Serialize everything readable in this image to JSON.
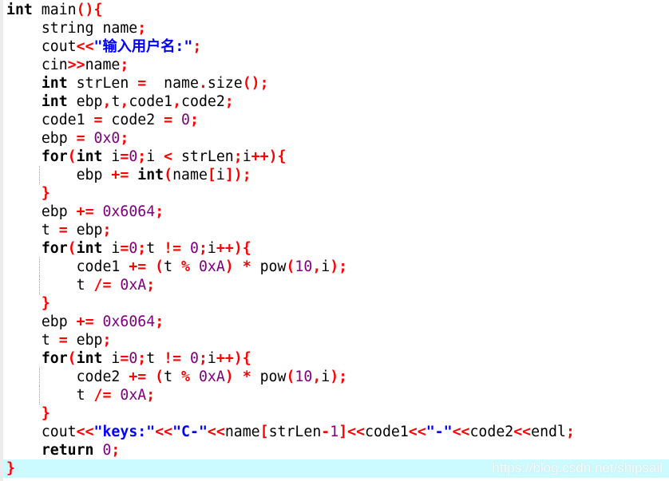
{
  "colors": {
    "keyword": "#000000",
    "operator": "#ff0000",
    "number": "#800080",
    "string": "#0000ff",
    "current_line": "#ccfbff"
  },
  "watermark": "https://blog.csdn.net/shipsail",
  "current_line": 26,
  "lines": [
    {
      "indent": 0,
      "tokens": [
        [
          "int",
          "k"
        ],
        [
          " main",
          "p"
        ],
        [
          "(){",
          "o"
        ]
      ]
    },
    {
      "indent": 1,
      "tokens": [
        [
          "string name",
          "p"
        ],
        [
          ";",
          "o"
        ]
      ]
    },
    {
      "indent": 1,
      "tokens": [
        [
          "cout",
          "p"
        ],
        [
          "<<",
          "o"
        ],
        [
          "\"输入用户名:\"",
          "s"
        ],
        [
          ";",
          "o"
        ]
      ]
    },
    {
      "indent": 1,
      "tokens": [
        [
          "cin",
          "p"
        ],
        [
          ">>",
          "o"
        ],
        [
          "name",
          "p"
        ],
        [
          ";",
          "o"
        ]
      ]
    },
    {
      "indent": 1,
      "tokens": [
        [
          "int",
          "k"
        ],
        [
          " strLen ",
          "p"
        ],
        [
          "=",
          "o"
        ],
        [
          "  name",
          "p"
        ],
        [
          ".",
          "o"
        ],
        [
          "size",
          "p"
        ],
        [
          "();",
          "o"
        ]
      ]
    },
    {
      "indent": 1,
      "tokens": [
        [
          "int",
          "k"
        ],
        [
          " ebp",
          "p"
        ],
        [
          ",",
          "o"
        ],
        [
          "t",
          "p"
        ],
        [
          ",",
          "o"
        ],
        [
          "code1",
          "p"
        ],
        [
          ",",
          "o"
        ],
        [
          "code2",
          "p"
        ],
        [
          ";",
          "o"
        ]
      ]
    },
    {
      "indent": 1,
      "tokens": [
        [
          "code1 ",
          "p"
        ],
        [
          "=",
          "o"
        ],
        [
          " code2 ",
          "p"
        ],
        [
          "=",
          "o"
        ],
        [
          " ",
          "p"
        ],
        [
          "0",
          "n"
        ],
        [
          ";",
          "o"
        ]
      ]
    },
    {
      "indent": 1,
      "tokens": [
        [
          "ebp ",
          "p"
        ],
        [
          "=",
          "o"
        ],
        [
          " ",
          "p"
        ],
        [
          "0x0",
          "n"
        ],
        [
          ";",
          "o"
        ]
      ]
    },
    {
      "indent": 1,
      "tokens": [
        [
          "for",
          "k"
        ],
        [
          "(",
          "o"
        ],
        [
          "int",
          "k"
        ],
        [
          " i",
          "p"
        ],
        [
          "=",
          "o"
        ],
        [
          "0",
          "n"
        ],
        [
          ";",
          "o"
        ],
        [
          "i ",
          "p"
        ],
        [
          "<",
          "o"
        ],
        [
          " strLen",
          "p"
        ],
        [
          ";",
          "o"
        ],
        [
          "i",
          "p"
        ],
        [
          "++){",
          "o"
        ]
      ]
    },
    {
      "indent": 2,
      "tokens": [
        [
          "ebp ",
          "p"
        ],
        [
          "+=",
          "o"
        ],
        [
          " ",
          "p"
        ],
        [
          "int",
          "k"
        ],
        [
          "(",
          "o"
        ],
        [
          "name",
          "p"
        ],
        [
          "[",
          "o"
        ],
        [
          "i",
          "p"
        ],
        [
          "]);",
          "o"
        ]
      ]
    },
    {
      "indent": 1,
      "tokens": [
        [
          "}",
          "o"
        ]
      ]
    },
    {
      "indent": 1,
      "tokens": [
        [
          "ebp ",
          "p"
        ],
        [
          "+=",
          "o"
        ],
        [
          " ",
          "p"
        ],
        [
          "0x6064",
          "n"
        ],
        [
          ";",
          "o"
        ]
      ]
    },
    {
      "indent": 1,
      "tokens": [
        [
          "t ",
          "p"
        ],
        [
          "=",
          "o"
        ],
        [
          " ebp",
          "p"
        ],
        [
          ";",
          "o"
        ]
      ]
    },
    {
      "indent": 1,
      "tokens": [
        [
          "for",
          "k"
        ],
        [
          "(",
          "o"
        ],
        [
          "int",
          "k"
        ],
        [
          " i",
          "p"
        ],
        [
          "=",
          "o"
        ],
        [
          "0",
          "n"
        ],
        [
          ";",
          "o"
        ],
        [
          "t ",
          "p"
        ],
        [
          "!=",
          "o"
        ],
        [
          " ",
          "p"
        ],
        [
          "0",
          "n"
        ],
        [
          ";",
          "o"
        ],
        [
          "i",
          "p"
        ],
        [
          "++){",
          "o"
        ]
      ]
    },
    {
      "indent": 2,
      "tokens": [
        [
          "code1 ",
          "p"
        ],
        [
          "+=",
          "o"
        ],
        [
          " ",
          "p"
        ],
        [
          "(",
          "o"
        ],
        [
          "t ",
          "p"
        ],
        [
          "%",
          "o"
        ],
        [
          " ",
          "p"
        ],
        [
          "0xA",
          "n"
        ],
        [
          ")",
          "o"
        ],
        [
          " ",
          "p"
        ],
        [
          "*",
          "o"
        ],
        [
          " pow",
          "p"
        ],
        [
          "(",
          "o"
        ],
        [
          "10",
          "n"
        ],
        [
          ",",
          "o"
        ],
        [
          "i",
          "p"
        ],
        [
          ");",
          "o"
        ]
      ]
    },
    {
      "indent": 2,
      "tokens": [
        [
          "t ",
          "p"
        ],
        [
          "/=",
          "o"
        ],
        [
          " ",
          "p"
        ],
        [
          "0xA",
          "n"
        ],
        [
          ";",
          "o"
        ]
      ]
    },
    {
      "indent": 1,
      "tokens": [
        [
          "}",
          "o"
        ]
      ]
    },
    {
      "indent": 1,
      "tokens": [
        [
          "ebp ",
          "p"
        ],
        [
          "+=",
          "o"
        ],
        [
          " ",
          "p"
        ],
        [
          "0x6064",
          "n"
        ],
        [
          ";",
          "o"
        ]
      ]
    },
    {
      "indent": 1,
      "tokens": [
        [
          "t ",
          "p"
        ],
        [
          "=",
          "o"
        ],
        [
          " ebp",
          "p"
        ],
        [
          ";",
          "o"
        ]
      ]
    },
    {
      "indent": 1,
      "tokens": [
        [
          "for",
          "k"
        ],
        [
          "(",
          "o"
        ],
        [
          "int",
          "k"
        ],
        [
          " i",
          "p"
        ],
        [
          "=",
          "o"
        ],
        [
          "0",
          "n"
        ],
        [
          ";",
          "o"
        ],
        [
          "t ",
          "p"
        ],
        [
          "!=",
          "o"
        ],
        [
          " ",
          "p"
        ],
        [
          "0",
          "n"
        ],
        [
          ";",
          "o"
        ],
        [
          "i",
          "p"
        ],
        [
          "++){",
          "o"
        ]
      ]
    },
    {
      "indent": 2,
      "tokens": [
        [
          "code2 ",
          "p"
        ],
        [
          "+=",
          "o"
        ],
        [
          " ",
          "p"
        ],
        [
          "(",
          "o"
        ],
        [
          "t ",
          "p"
        ],
        [
          "%",
          "o"
        ],
        [
          " ",
          "p"
        ],
        [
          "0xA",
          "n"
        ],
        [
          ")",
          "o"
        ],
        [
          " ",
          "p"
        ],
        [
          "*",
          "o"
        ],
        [
          " pow",
          "p"
        ],
        [
          "(",
          "o"
        ],
        [
          "10",
          "n"
        ],
        [
          ",",
          "o"
        ],
        [
          "i",
          "p"
        ],
        [
          ");",
          "o"
        ]
      ]
    },
    {
      "indent": 2,
      "tokens": [
        [
          "t ",
          "p"
        ],
        [
          "/=",
          "o"
        ],
        [
          " ",
          "p"
        ],
        [
          "0xA",
          "n"
        ],
        [
          ";",
          "o"
        ]
      ]
    },
    {
      "indent": 1,
      "tokens": [
        [
          "}",
          "o"
        ]
      ]
    },
    {
      "indent": 1,
      "tokens": [
        [
          "cout",
          "p"
        ],
        [
          "<<",
          "o"
        ],
        [
          "\"keys:\"",
          "s"
        ],
        [
          "<<",
          "o"
        ],
        [
          "\"C-\"",
          "s"
        ],
        [
          "<<",
          "o"
        ],
        [
          "name",
          "p"
        ],
        [
          "[",
          "o"
        ],
        [
          "strLen",
          "p"
        ],
        [
          "-",
          "o"
        ],
        [
          "1",
          "n"
        ],
        [
          "]<<",
          "o"
        ],
        [
          "code1",
          "p"
        ],
        [
          "<<",
          "o"
        ],
        [
          "\"-\"",
          "s"
        ],
        [
          "<<",
          "o"
        ],
        [
          "code2",
          "p"
        ],
        [
          "<<",
          "o"
        ],
        [
          "endl",
          "p"
        ],
        [
          ";",
          "o"
        ]
      ]
    },
    {
      "indent": 1,
      "tokens": [
        [
          "return",
          "k"
        ],
        [
          " ",
          "p"
        ],
        [
          "0",
          "n"
        ],
        [
          ";",
          "o"
        ]
      ]
    },
    {
      "indent": 0,
      "tokens": [
        [
          "}",
          "o"
        ]
      ]
    }
  ]
}
